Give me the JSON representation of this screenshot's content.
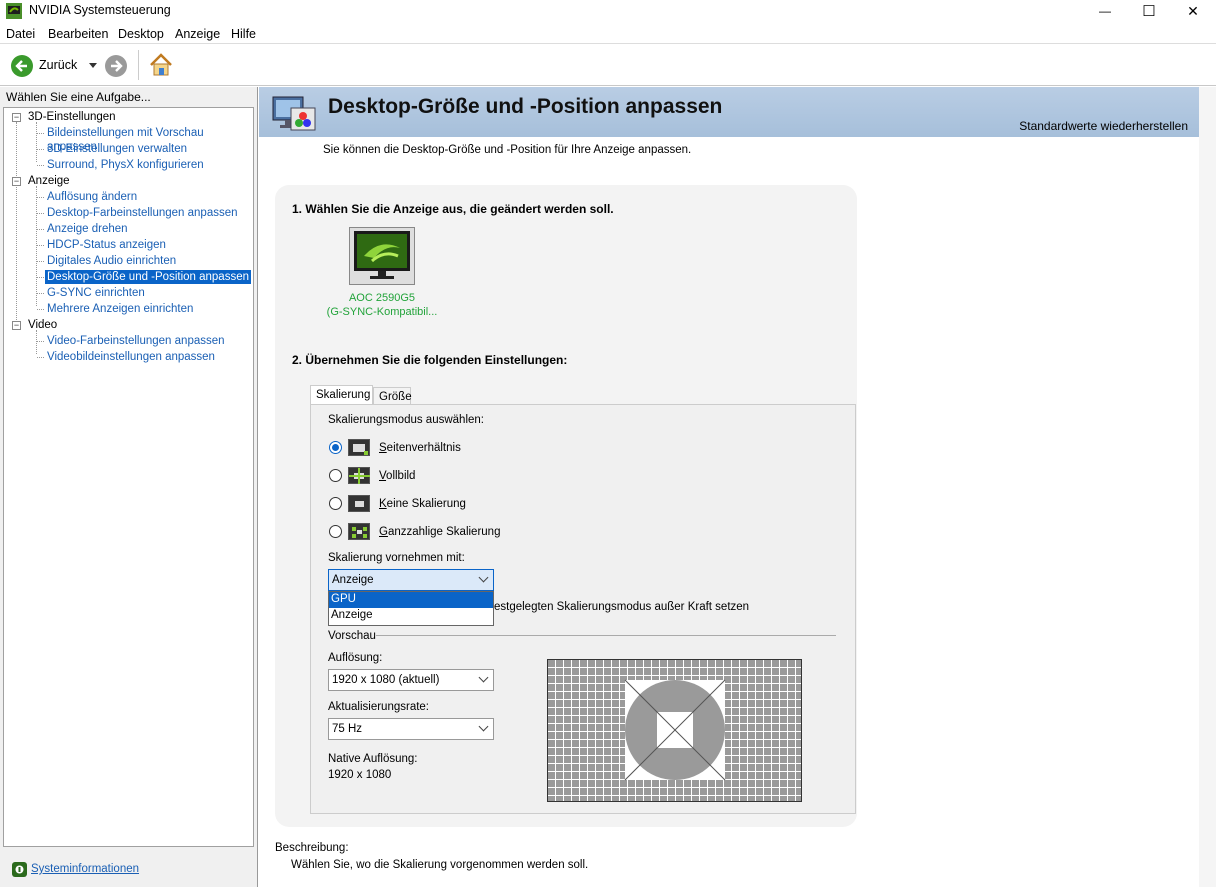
{
  "window": {
    "title": "NVIDIA Systemsteuerung",
    "controls": {
      "minimize": "—",
      "maximize": "☐",
      "close": "✕"
    }
  },
  "menu": [
    "Datei",
    "Bearbeiten",
    "Desktop",
    "Anzeige",
    "Hilfe"
  ],
  "toolbar": {
    "back_label": "Zurück"
  },
  "left": {
    "task_label": "Wählen Sie eine Aufgabe...",
    "categories": [
      {
        "label": "3D-Einstellungen",
        "items": [
          "Bildeinstellungen mit Vorschau anpassen",
          "3D-Einstellungen verwalten",
          "Surround, PhysX konfigurieren"
        ]
      },
      {
        "label": "Anzeige",
        "items": [
          "Auflösung ändern",
          "Desktop-Farbeinstellungen anpassen",
          "Anzeige drehen",
          "HDCP-Status anzeigen",
          "Digitales Audio einrichten",
          "Desktop-Größe und -Position anpassen",
          "G-SYNC einrichten",
          "Mehrere Anzeigen einrichten"
        ]
      },
      {
        "label": "Video",
        "items": [
          "Video-Farbeinstellungen anpassen",
          "Videobildeinstellungen anpassen"
        ]
      }
    ],
    "selected": "Desktop-Größe und -Position anpassen",
    "sysinfo_label": "Systeminformationen"
  },
  "page": {
    "title": "Desktop-Größe und -Position anpassen",
    "restore_label": "Standardwerte wiederherstellen",
    "intro": "Sie können die Desktop-Größe und -Position für Ihre Anzeige anpassen.",
    "step1": "1. Wählen Sie die Anzeige aus, die geändert werden soll.",
    "monitor_name": "AOC 2590G5",
    "monitor_sub": "(G-SYNC-Kompatibil...",
    "step2": "2. Übernehmen Sie die folgenden Einstellungen:",
    "tabs": [
      "Skalierung",
      "Größe"
    ],
    "scaling_mode_label": "Skalierungsmodus auswählen:",
    "modes": [
      {
        "key": "S",
        "rest": "eitenverhältnis",
        "checked": true
      },
      {
        "key": "V",
        "rest": "ollbild",
        "checked": false
      },
      {
        "key": "K",
        "rest": "eine Skalierung",
        "checked": false
      },
      {
        "key": "G",
        "rest": "anzzahlige Skalierung",
        "checked": false
      }
    ],
    "perform_label": "Skalierung vornehmen mit:",
    "perform_value": "Anzeige",
    "dropdown_options": [
      "GPU",
      "Anzeige"
    ],
    "override_label_visible": "estgelegten Skalierungsmodus außer Kraft setzen",
    "preview_label": "Vorschau",
    "resolution_label": "Auflösung:",
    "resolution_value": "1920 x 1080 (aktuell)",
    "refresh_label": "Aktualisierungsrate:",
    "refresh_value": "75 Hz",
    "native_label": "Native Auflösung:",
    "native_value": "1920 x 1080",
    "description_label": "Beschreibung:",
    "description_text": "Wählen Sie, wo die Skalierung vorgenommen werden soll."
  },
  "colors": {
    "accent": "#0a64c8",
    "banner": "#b3c8e0",
    "monitor_label": "#22a33a",
    "link": "#1a5fb4"
  }
}
